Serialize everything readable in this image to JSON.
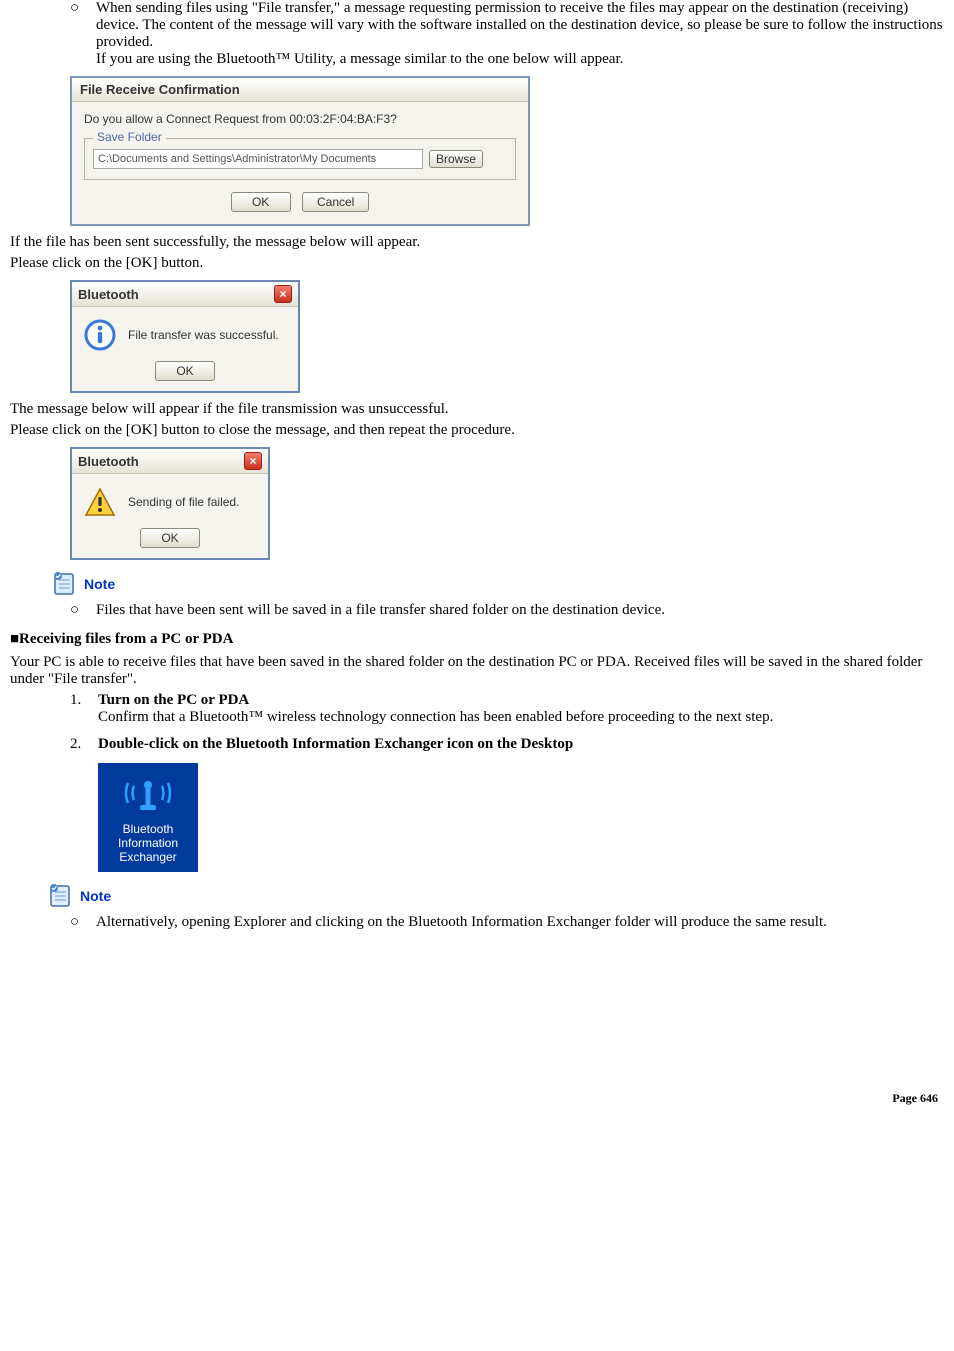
{
  "top_bullet": {
    "mark": "○",
    "line1": "When sending files using \"File transfer,\" a message requesting permission to receive the files may appear on the destination (receiving) device. The content of the message will vary with the software installed on the destination device, so please be sure to follow the instructions provided.",
    "line2": "If you are using the Bluetooth™ Utility, a message similar to the one below will appear."
  },
  "dlg_confirm": {
    "title": "File Receive Confirmation",
    "question": "Do you allow a Connect Request from 00:03:2F:04:BA:F3?",
    "legend": "Save Folder",
    "path": "C:\\Documents and Settings\\Administrator\\My Documents",
    "browse": "Browse",
    "ok": "OK",
    "cancel": "Cancel"
  },
  "after_confirm": {
    "line1": "If the file has been sent successfully, the message below will appear.",
    "line2": "Please click on the [OK] button."
  },
  "msg_success": {
    "title": "Bluetooth",
    "text": "File transfer was successful.",
    "ok": "OK"
  },
  "after_success": {
    "line1": "The message below will appear if the file transmission was unsuccessful.",
    "line2": "Please click on the [OK] button to close the message, and then repeat the procedure."
  },
  "msg_fail": {
    "title": "Bluetooth",
    "text": "Sending of file failed.",
    "ok": "OK"
  },
  "note1": {
    "label": "Note",
    "bullet_mark": "○",
    "bullet_text": "Files that have been sent will be saved in a file transfer shared folder on the destination device."
  },
  "section": {
    "heading": "■Receiving files from a PC or PDA",
    "intro": "Your PC is able to receive files that have been saved in the shared folder on the destination PC or PDA. Received files will be saved in the shared folder under \"File transfer\"."
  },
  "steps": {
    "s1_num": "1.",
    "s1_title": "Turn on the PC or PDA",
    "s1_body": "Confirm that a Bluetooth™ wireless technology connection has been enabled before proceeding to the next step.",
    "s2_num": "2.",
    "s2_title": "Double-click on the Bluetooth Information Exchanger icon on the Desktop"
  },
  "desktop_tile": {
    "line1": "Bluetooth",
    "line2": "Information",
    "line3": "Exchanger"
  },
  "note2": {
    "label": "Note",
    "bullet_mark": "○",
    "bullet_text": "Alternatively, opening Explorer and clicking on the Bluetooth Information Exchanger folder will produce the same result."
  },
  "page_number": "Page 646"
}
